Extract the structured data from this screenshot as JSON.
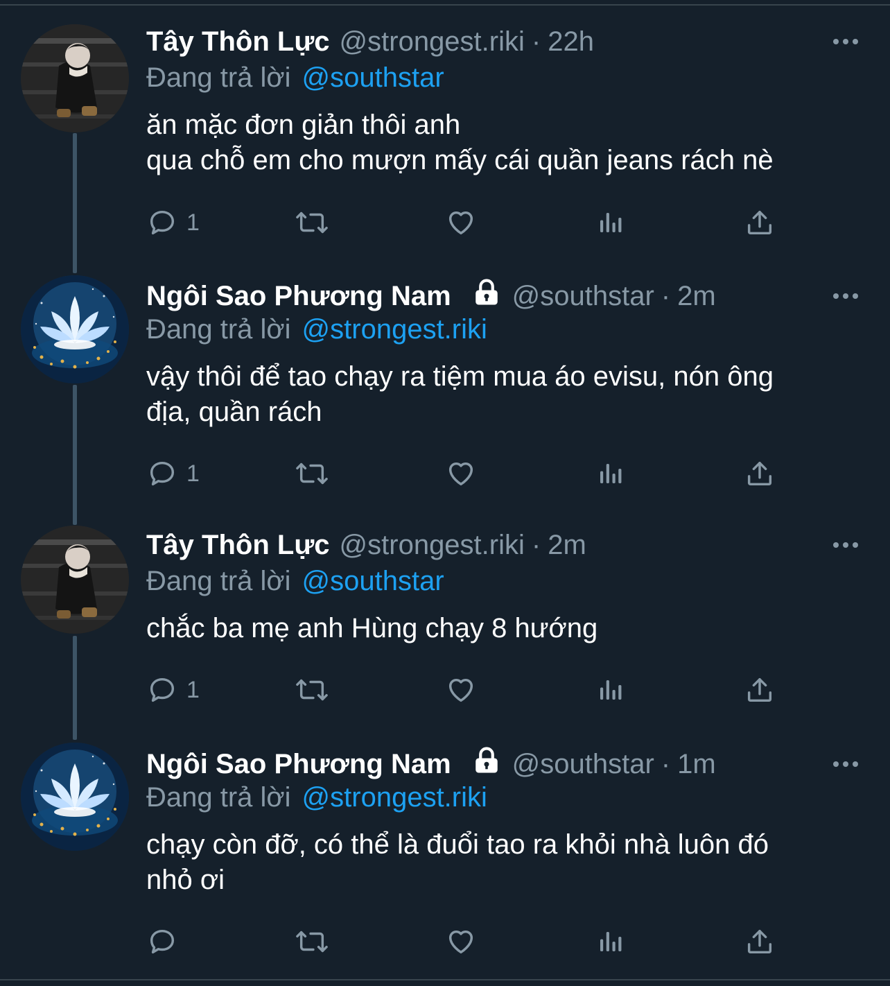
{
  "theme": {
    "background": "#15202b",
    "text": "#ffffff",
    "muted": "#8899a6",
    "link": "#1da1f2",
    "divider": "#38444d"
  },
  "reply_prefix": "Đang trả lời",
  "separator": "·",
  "tweets": [
    {
      "name": "Tây Thôn Lực",
      "handle": "@strongest.riki",
      "time": "22h",
      "locked": false,
      "avatar": "photo-avatar",
      "reply_to": "@southstar",
      "text": "ăn mặc đơn giản thôi anh\nqua chỗ em cho mượn mấy cái quần jeans rách nè",
      "reply_count": "1"
    },
    {
      "name": "Ngôi Sao Phương Nam",
      "handle": "@southstar",
      "time": "2m",
      "locked": true,
      "avatar": "lotus-avatar",
      "reply_to": "@strongest.riki",
      "text": "vậy thôi để tao chạy ra tiệm mua áo evisu, nón ông\nđịa, quần rách",
      "reply_count": "1"
    },
    {
      "name": "Tây Thôn Lực",
      "handle": "@strongest.riki",
      "time": "2m",
      "locked": false,
      "avatar": "photo-avatar",
      "reply_to": "@southstar",
      "text": "chắc ba mẹ anh Hùng chạy 8 hướng",
      "reply_count": "1"
    },
    {
      "name": "Ngôi Sao Phương Nam",
      "handle": "@southstar",
      "time": "1m",
      "locked": true,
      "avatar": "lotus-avatar",
      "reply_to": "@strongest.riki",
      "text": "chạy còn đỡ, có thể là đuổi tao ra khỏi nhà luôn đó\nnhỏ ơi",
      "reply_count": ""
    }
  ],
  "icons": {
    "more": "more-icon",
    "reply": "reply-icon",
    "retweet": "retweet-icon",
    "like": "like-icon",
    "analytics": "analytics-icon",
    "share": "share-icon",
    "lock": "lock-icon"
  }
}
